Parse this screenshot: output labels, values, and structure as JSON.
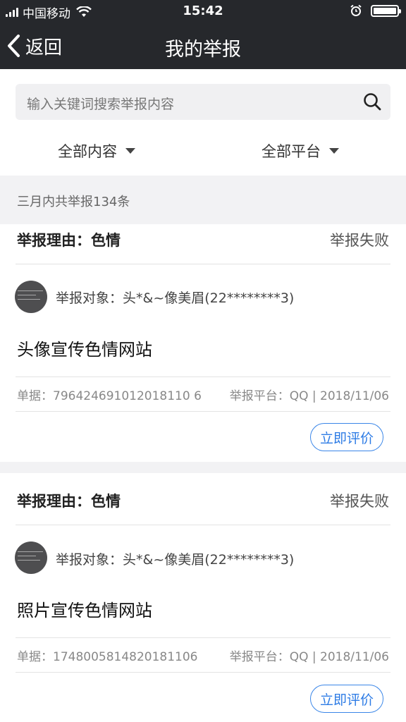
{
  "status_bar": {
    "carrier": "中国移动",
    "time": "15:42"
  },
  "nav": {
    "back_label": "返回",
    "title": "我的举报"
  },
  "search": {
    "placeholder": "输入关键词搜索举报内容"
  },
  "filters": {
    "content": "全部内容",
    "platform": "全部平台"
  },
  "summary": {
    "count_text": "三月内共举报134条"
  },
  "reports": [
    {
      "reason": "举报理由：色情",
      "status": "举报失败",
      "target": "举报对象：头*&~像美眉(22********3)",
      "headline": "头像宣传色情网站",
      "receipt": "单据：796424691012018110 6",
      "platform_date": "举报平台：QQ | 2018/11/06",
      "rate_label": "立即评价"
    },
    {
      "reason": "举报理由：色情",
      "status": "举报失败",
      "target": "举报对象：头*&~像美眉(22********3)",
      "headline": "照片宣传色情网站",
      "receipt": "单据：1748005814820181106",
      "platform_date": "举报平台：QQ | 2018/11/06",
      "rate_label": "立即评价"
    }
  ],
  "colors": {
    "header_bg": "#26282c",
    "accent": "#2c7be5",
    "page_bg": "#f2f2f4"
  }
}
